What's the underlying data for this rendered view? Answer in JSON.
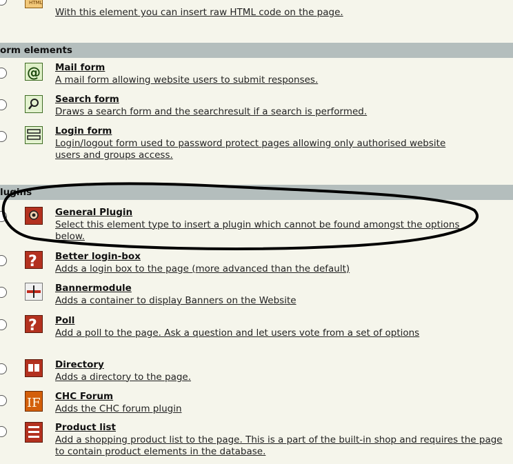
{
  "html_item": {
    "description": "With this element you can insert raw HTML code on the page.",
    "icon": "html-icon"
  },
  "sections": {
    "form_elements": "orm elements",
    "plugins": "lugins"
  },
  "form_items": [
    {
      "title": "Mail form",
      "description": "A mail form allowing website users to submit responses.",
      "icon": "at-sign-icon"
    },
    {
      "title": "Search form",
      "description": "Draws a search form and the searchresult if a search is performed.",
      "icon": "magnifier-icon"
    },
    {
      "title": "Login form",
      "description": "Login/logout form used to password protect pages allowing only authorised website users and groups access.",
      "icon": "login-form-icon"
    }
  ],
  "plugin_items": [
    {
      "title": "General Plugin",
      "description": "Select this element type to insert a plugin which cannot be found amongst the options below.",
      "icon": "plugin-icon"
    },
    {
      "title": "Better login-box",
      "description": "Adds a login box to the page (more advanced than the default)",
      "icon": "question-icon"
    },
    {
      "title": "Bannermodule",
      "description": "Adds a container to display Banners on the Website",
      "icon": "banner-icon"
    },
    {
      "title": "Poll",
      "description": "Add a poll to the page. Ask a question and let users vote from a set of options",
      "icon": "question-icon"
    },
    {
      "title": "Directory",
      "description": "Adds a directory to the page.",
      "icon": "book-icon"
    },
    {
      "title": "CHC Forum",
      "description": "Adds the CHC forum plugin",
      "icon": "forum-icon"
    },
    {
      "title": "Product list",
      "description": "Add a shopping product list to the page. This is a part of the built-in shop and requires the page to contain product elements in the database.",
      "icon": "list-icon"
    }
  ],
  "colors": {
    "section_header_bg": "#b4bebd",
    "page_bg": "#f5f5eb",
    "annotation_stroke": "#000000",
    "icon_red": "#b3311f",
    "icon_green": "#4e9a3a"
  }
}
